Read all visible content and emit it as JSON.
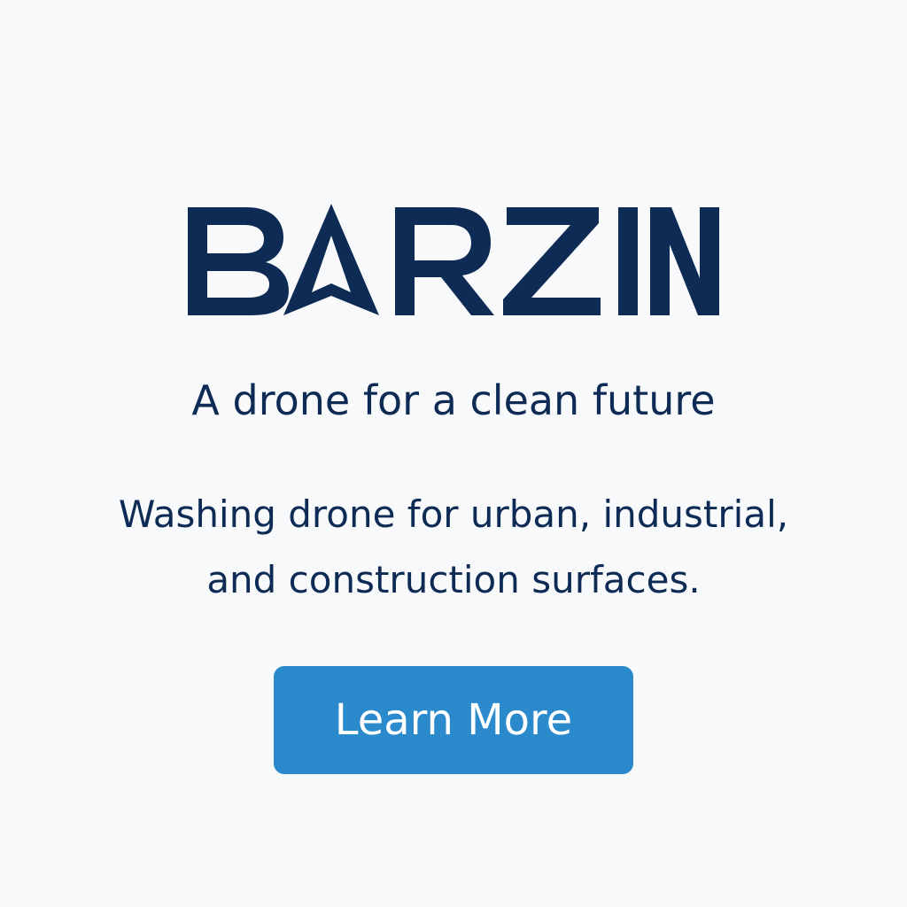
{
  "brand": {
    "name": "BARZIN",
    "color": "#0d2b55"
  },
  "hero": {
    "tagline": "A drone for a clean future",
    "description_lines": [
      "Washing drone for urban, industrial,",
      "and construction surfaces."
    ]
  },
  "cta": {
    "label": "Learn More",
    "color": "#2a8acb"
  }
}
